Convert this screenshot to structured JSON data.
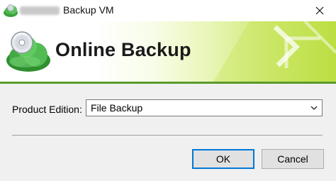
{
  "window": {
    "title_obscured": "Cloud",
    "title": "Backup VM",
    "close_glyph": "✕"
  },
  "banner": {
    "title": "Online Backup",
    "logo_icon": "cloud-disc-icon",
    "accent_colors": [
      "#ffffff",
      "#cfe975",
      "#b9dd3e"
    ]
  },
  "form": {
    "edition_label": "Product Edition:",
    "edition_value": "File Backup"
  },
  "buttons": {
    "ok": "OK",
    "cancel": "Cancel"
  },
  "colors": {
    "focus_border": "#0078d7",
    "rule_green": "#5a9a2a"
  }
}
